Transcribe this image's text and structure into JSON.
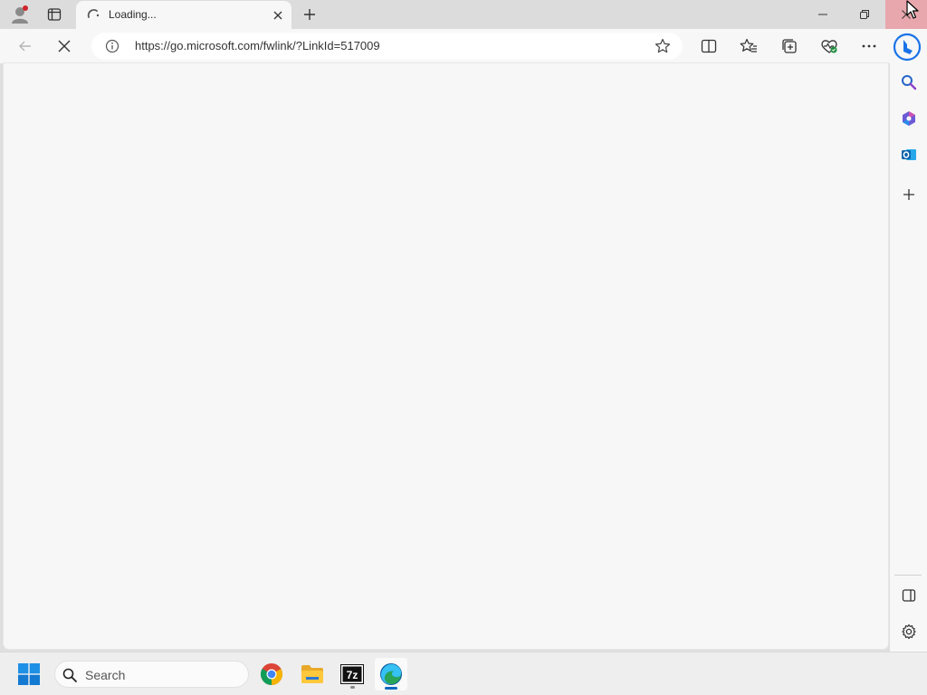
{
  "tab": {
    "title": "Loading...",
    "close_icon": "close-icon"
  },
  "tabstrip": {
    "profile_icon": "profile-icon",
    "workspaces_icon": "workspaces-icon",
    "newtab_icon": "plus-icon"
  },
  "window_controls": {
    "minimize_icon": "minimize-icon",
    "restore_icon": "restore-icon",
    "close_icon": "close-icon",
    "close_hover_color": "#e8a7ad"
  },
  "toolbar": {
    "url": "https://go.microsoft.com/fwlink/?LinkId=517009",
    "back_icon": "arrow-left-icon",
    "stop_icon": "stop-loading-icon",
    "site_info_icon": "info-icon",
    "favorite_icon": "star-icon",
    "split_screen_icon": "split-screen-icon",
    "favorites_icon": "favorites-icon",
    "collections_icon": "collections-icon",
    "performance_icon": "performance-icon",
    "more_icon": "ellipsis-icon",
    "copilot_icon": "bing-icon"
  },
  "sidebar": {
    "items": [
      "search-icon",
      "copilot-apps-icon",
      "outlook-icon",
      "plus-icon"
    ],
    "bottom": [
      "sidebar-toggle-icon",
      "gear-icon"
    ]
  },
  "taskbar": {
    "search_placeholder": "Search",
    "apps": [
      "chrome-icon",
      "file-explorer-icon",
      "7zip-icon",
      "edge-icon"
    ],
    "accent_color": "#0067c0"
  }
}
